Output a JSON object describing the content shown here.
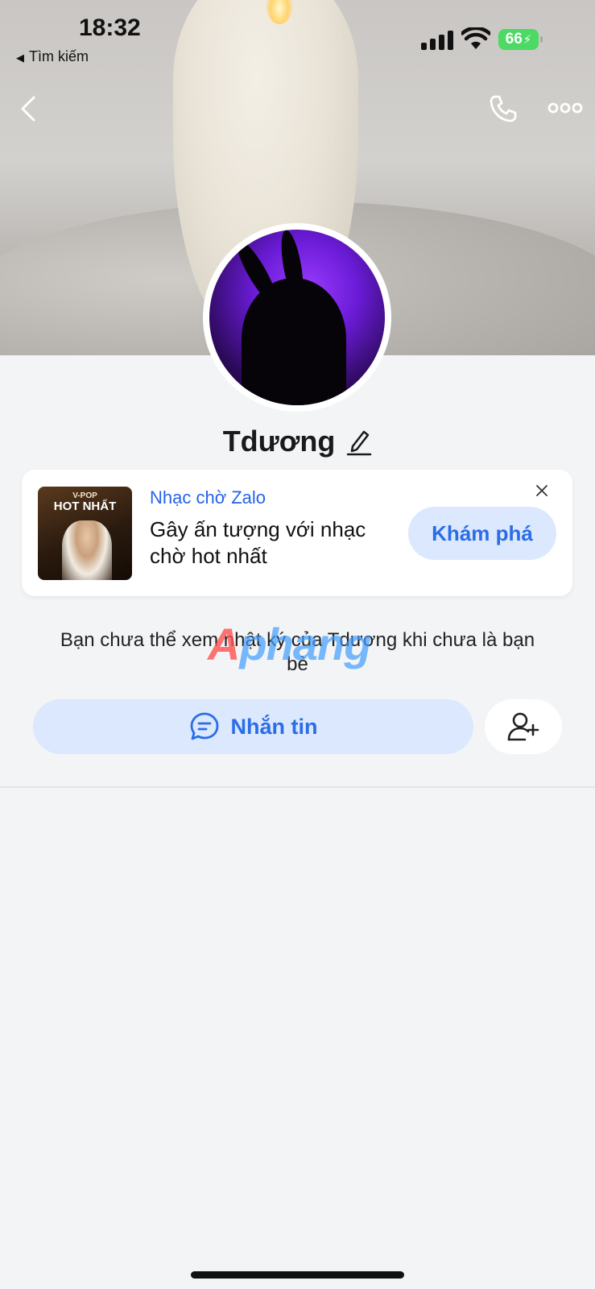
{
  "status_bar": {
    "time": "18:32",
    "back_app": "Tìm kiếm",
    "battery": "66"
  },
  "profile": {
    "name": "Tdương"
  },
  "music_card": {
    "album_genre": "V-POP",
    "album_title": "HOT NHẤT",
    "subtitle": "Nhạc chờ Zalo",
    "text": "Gây ấn tượng với nhạc chờ hot nhất",
    "button_label": "Khám phá"
  },
  "info_text": "Bạn chưa thể xem nhật ký của Tdương khi chưa là bạn bè",
  "watermark": {
    "first": "A",
    "rest": "phang"
  },
  "actions": {
    "message_label": "Nhắn tin"
  },
  "colors": {
    "accent": "#2b6de8",
    "accent_light": "#dbe8fd",
    "battery": "#4cd964",
    "background": "#f3f4f6"
  },
  "icons": {
    "back": "chevron-left-icon",
    "call": "phone-icon",
    "more": "more-horizontal-icon",
    "edit": "pencil-icon",
    "close": "close-icon",
    "message": "chat-bubble-icon",
    "add_friend": "add-user-icon"
  }
}
